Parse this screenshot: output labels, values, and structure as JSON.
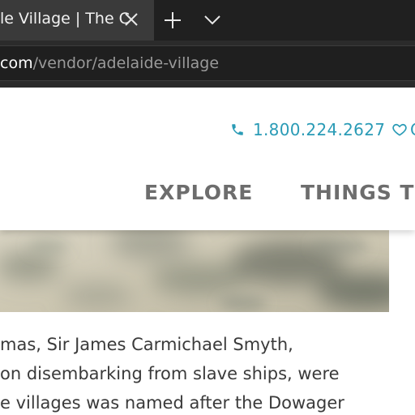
{
  "browser": {
    "tab_title": "le Village | The C",
    "url_domain": "com",
    "url_path": "/vendor/adelaide-village",
    "icons": {
      "close": "close-icon",
      "new_tab": "plus-icon",
      "tab_list": "chevron-down-icon"
    }
  },
  "header": {
    "phone": "1.800.224.2627",
    "favorites_label": "C",
    "nav": {
      "explore": "EXPLORE",
      "things_to": "THINGS TO"
    }
  },
  "article": {
    "lines": [
      "mas, Sir James Carmichael Smyth,",
      "on disembarking from slave ships, were",
      "e villages was named after the Dowager"
    ]
  },
  "colors": {
    "accent": "#2a9bb6",
    "nav_text": "#6d6d6d",
    "body_text": "#3a3a3a",
    "chrome_dark": "#202020"
  }
}
